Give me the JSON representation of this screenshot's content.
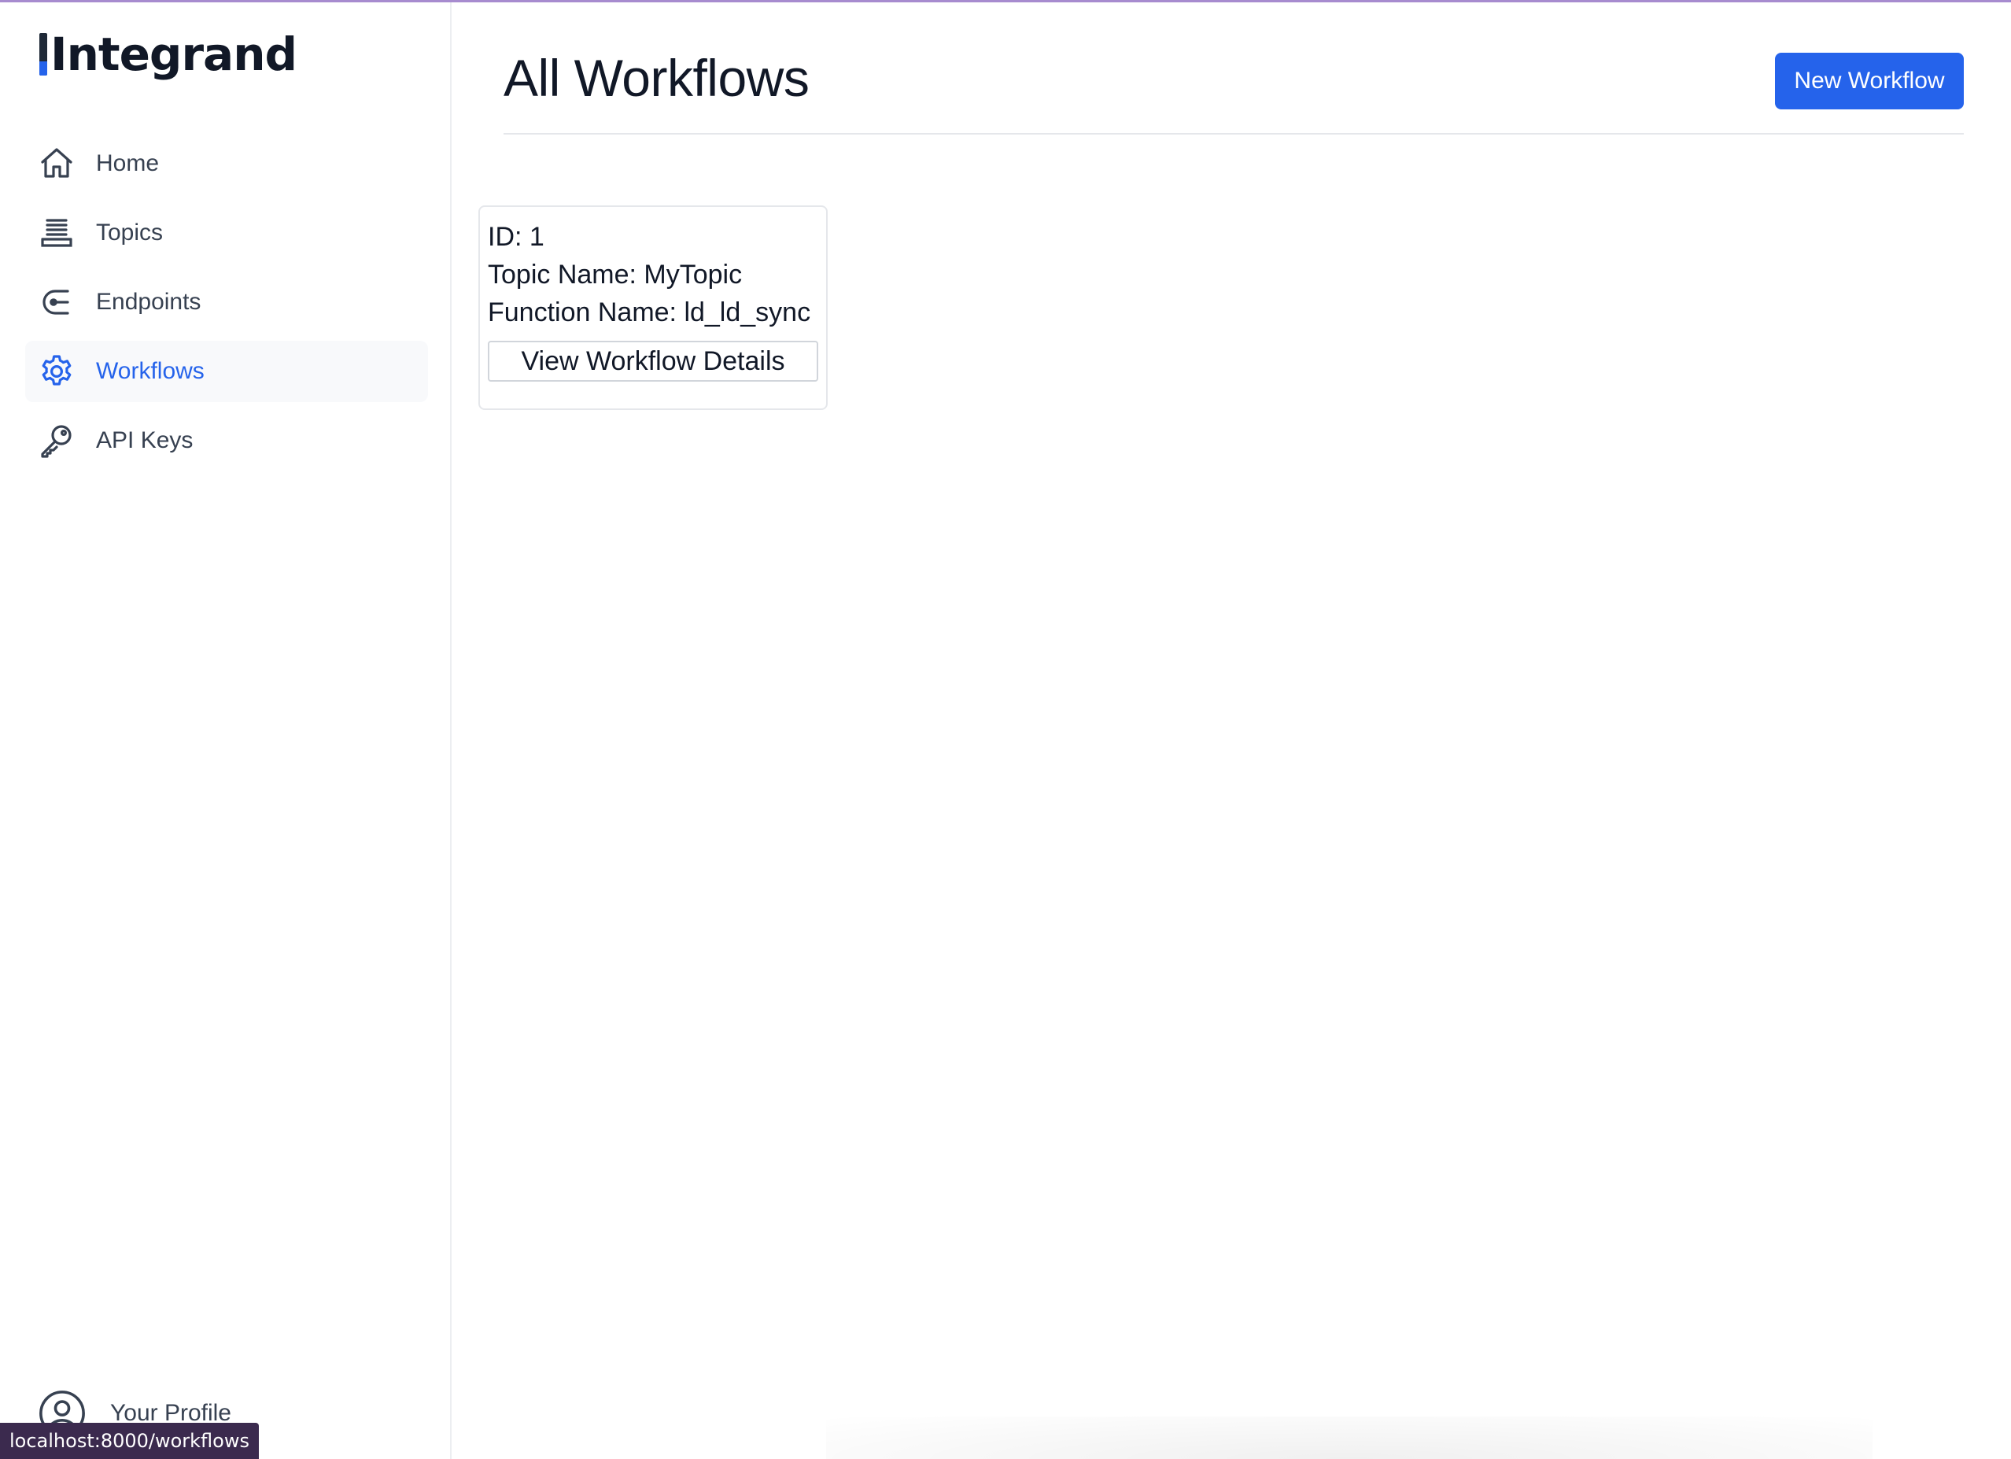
{
  "app": {
    "logo_text": "Integrand"
  },
  "sidebar": {
    "items": [
      {
        "label": "Home",
        "icon": "home-icon"
      },
      {
        "label": "Topics",
        "icon": "stack-icon"
      },
      {
        "label": "Endpoints",
        "icon": "endpoint-icon"
      },
      {
        "label": "Workflows",
        "icon": "gear-icon",
        "active": true
      },
      {
        "label": "API Keys",
        "icon": "key-icon"
      }
    ],
    "profile_label": "Your Profile"
  },
  "header": {
    "title": "All Workflows",
    "new_button": "New Workflow"
  },
  "workflows": [
    {
      "id_line": "ID: 1",
      "topic_line": "Topic Name: MyTopic",
      "function_line": "Function Name: ld_ld_sync",
      "details_button": "View Workflow Details"
    }
  ],
  "status_bar": {
    "url": "localhost:8000/workflows"
  },
  "colors": {
    "accent": "#2563eb",
    "text": "#111827",
    "muted": "#374151"
  }
}
